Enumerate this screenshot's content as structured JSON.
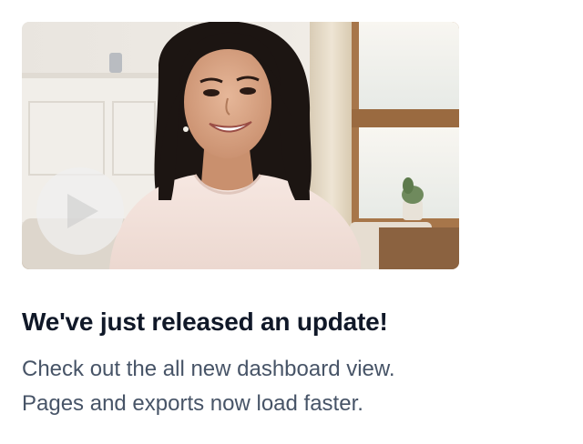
{
  "video": {
    "thumbnail_icon": "video-thumbnail-woman-smiling",
    "play_icon": "play-icon"
  },
  "title": "We've just released an update!",
  "description": {
    "line1": "Check out the all new dashboard view.",
    "line2": "Pages and exports now load faster."
  },
  "colors": {
    "title": "#101828",
    "description": "#475467",
    "background": "#ffffff"
  }
}
